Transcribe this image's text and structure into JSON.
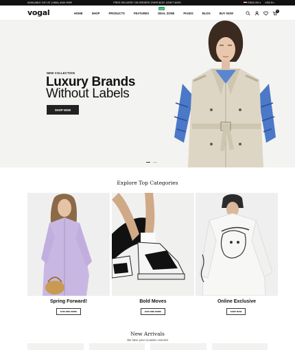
{
  "topbar": {
    "left_text": "AVAILABLE 24/7 AT (+666) 4444 9999",
    "center_text": "FREE DELIVERY ON ORDERS OVER $120. DON'T MISS.",
    "language": "ENGLISH",
    "currency": "USD $"
  },
  "header": {
    "logo": "vogal",
    "nav": [
      {
        "label": "HOME"
      },
      {
        "label": "SHOP"
      },
      {
        "label": "PRODUCTS"
      },
      {
        "label": "FEATURES"
      },
      {
        "label": "DEAL ZONE"
      },
      {
        "label": "PAGES"
      },
      {
        "label": "BLOG"
      },
      {
        "label": "BUY NOW"
      }
    ],
    "hot_badge": "HOT",
    "cart_count": "0",
    "icons": [
      "search-icon",
      "user-icon",
      "heart-icon",
      "cart-icon"
    ]
  },
  "hero": {
    "eyebrow": "NEW COLLECTION",
    "title_line1": "Luxury Brands",
    "title_line2": "Without Labels",
    "button": "SHOP NOW",
    "slides": 2,
    "active_slide": 1
  },
  "categories": {
    "title": "Explore Top Categories",
    "items": [
      {
        "name": "Spring Forward!",
        "button": "EXPLORE MORE"
      },
      {
        "name": "Bold Moves",
        "button": "EXPLORE MORE"
      },
      {
        "name": "Online Exclusive",
        "button": "SHOP NOW"
      }
    ]
  },
  "arrivals": {
    "title": "New Arrivals",
    "subtitle": "We have your occasion covered"
  },
  "colors": {
    "topbar_bg": "#111111",
    "hero_bg": "#f3f3f1",
    "button_bg": "#222222",
    "hot_badge": "#2aa866"
  }
}
